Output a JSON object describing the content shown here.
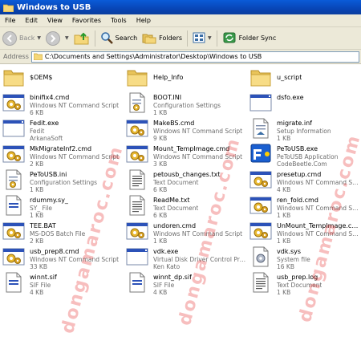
{
  "window": {
    "title": "Windows to USB"
  },
  "menu": [
    "File",
    "Edit",
    "View",
    "Favorites",
    "Tools",
    "Help"
  ],
  "toolbar": {
    "back": "Back",
    "search": "Search",
    "folders": "Folders",
    "folder_sync": "Folder Sync"
  },
  "address": {
    "label": "Address",
    "path": "C:\\Documents and Settings\\Administrator\\Desktop\\Windows to USB"
  },
  "watermark": "dongamaroc.com",
  "files": [
    {
      "icon": "folder",
      "name": "$OEM$",
      "desc": "",
      "size": ""
    },
    {
      "icon": "folder",
      "name": "Help_Info",
      "desc": "",
      "size": ""
    },
    {
      "icon": "folder",
      "name": "u_script",
      "desc": "",
      "size": ""
    },
    {
      "icon": "cmd",
      "name": "binifix4.cmd",
      "desc": "Windows NT Command Script",
      "size": "6 KB"
    },
    {
      "icon": "ini",
      "name": "BOOT.INI",
      "desc": "Configuration Settings",
      "size": "1 KB"
    },
    {
      "icon": "exe",
      "name": "dsfo.exe",
      "desc": "",
      "size": ""
    },
    {
      "icon": "exe",
      "name": "Fedit.exe",
      "desc": "Fedit",
      "size": "ArkanaSoft"
    },
    {
      "icon": "cmd",
      "name": "MakeBS.cmd",
      "desc": "Windows NT Command Script",
      "size": "9 KB"
    },
    {
      "icon": "inf",
      "name": "migrate.inf",
      "desc": "Setup Information",
      "size": "1 KB"
    },
    {
      "icon": "cmd",
      "name": "MkMigrateInf2.cmd",
      "desc": "Windows NT Command Script",
      "size": "2 KB"
    },
    {
      "icon": "cmd",
      "name": "Mount_TempImage.cmd",
      "desc": "Windows NT Command Script",
      "size": "3 KB"
    },
    {
      "icon": "petousb",
      "name": "PeToUSB.exe",
      "desc": "PeToUSB Application",
      "size": "CodeBeetle.Com"
    },
    {
      "icon": "ini",
      "name": "PeToUSB.ini",
      "desc": "Configuration Settings",
      "size": "1 KB"
    },
    {
      "icon": "txt",
      "name": "petousb_changes.txt",
      "desc": "Text Document",
      "size": "6 KB"
    },
    {
      "icon": "cmd",
      "name": "presetup.cmd",
      "desc": "Windows NT Command Script",
      "size": "4 KB"
    },
    {
      "icon": "generic",
      "name": "rdummy.sy_",
      "desc": "SY_ File",
      "size": "1 KB"
    },
    {
      "icon": "txt",
      "name": "ReadMe.txt",
      "desc": "Text Document",
      "size": "6 KB"
    },
    {
      "icon": "cmd",
      "name": "ren_fold.cmd",
      "desc": "Windows NT Command Script",
      "size": "1 KB"
    },
    {
      "icon": "cmd",
      "name": "TEE.BAT",
      "desc": "MS-DOS Batch File",
      "size": "2 KB"
    },
    {
      "icon": "cmd",
      "name": "undoren.cmd",
      "desc": "Windows NT Command Script",
      "size": "1 KB"
    },
    {
      "icon": "cmd",
      "name": "UnMount_TempImage.cmd",
      "desc": "Windows NT Command Script",
      "size": "1 KB"
    },
    {
      "icon": "cmd",
      "name": "usb_prep8.cmd",
      "desc": "Windows NT Command Script",
      "size": "33 KB"
    },
    {
      "icon": "exe",
      "name": "vdk.exe",
      "desc": "Virtual Disk Driver Control Pro...",
      "size": "Ken Kato"
    },
    {
      "icon": "sys",
      "name": "vdk.sys",
      "desc": "System file",
      "size": "16 KB"
    },
    {
      "icon": "generic",
      "name": "winnt.sif",
      "desc": "SIF File",
      "size": "4 KB"
    },
    {
      "icon": "generic",
      "name": "winnt_dp.sif",
      "desc": "SIF File",
      "size": "4 KB"
    },
    {
      "icon": "txt",
      "name": "usb_prep.log",
      "desc": "Text Document",
      "size": "1 KB"
    }
  ]
}
